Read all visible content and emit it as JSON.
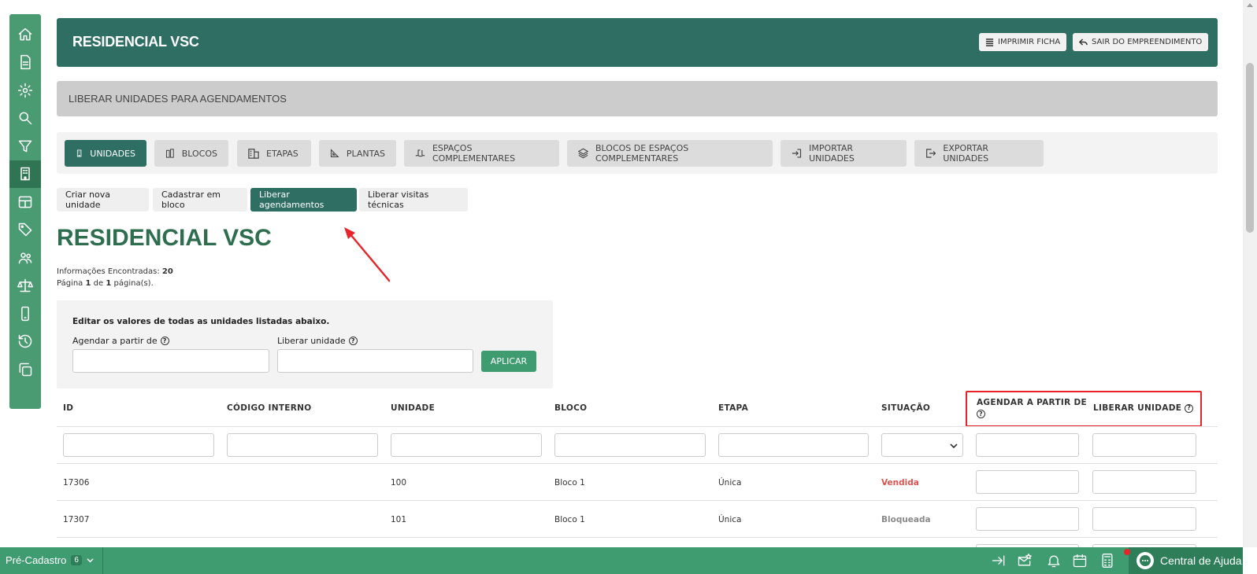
{
  "header": {
    "title": "RESIDENCIAL VSC",
    "print_label": "IMPRIMIR FICHA",
    "exit_label": "SAIR DO EMPREENDIMENTO"
  },
  "subbar": {
    "label": "LIBERAR UNIDADES PARA AGENDAMENTOS"
  },
  "tabs": [
    {
      "label": "UNIDADES",
      "icon": "building-icon",
      "active": true
    },
    {
      "label": "BLOCOS",
      "icon": "blocks-icon"
    },
    {
      "label": "ETAPAS",
      "icon": "stages-icon"
    },
    {
      "label": "PLANTAS",
      "icon": "plans-icon"
    },
    {
      "label": "ESPAÇOS COMPLEMENTARES",
      "icon": "pool-icon"
    },
    {
      "label": "BLOCOS DE ESPAÇOS COMPLEMENTARES",
      "icon": "layers-icon"
    },
    {
      "label": "IMPORTAR UNIDADES",
      "icon": "import-icon"
    },
    {
      "label": "EXPORTAR UNIDADES",
      "icon": "export-icon"
    }
  ],
  "subtabs": [
    {
      "label": "Criar nova unidade"
    },
    {
      "label": "Cadastrar em bloco"
    },
    {
      "label": "Liberar agendamentos",
      "active": true
    },
    {
      "label": "Liberar visitas técnicas"
    }
  ],
  "page_title": "RESIDENCIAL VSC",
  "info": {
    "found_label": "Informações Encontradas:",
    "found_count": "20",
    "page_prefix": "Página",
    "page_current": "1",
    "page_of": "de",
    "page_total": "1",
    "page_suffix": "página(s)."
  },
  "edit": {
    "title": "Editar os valores de todas as unidades listadas abaixo.",
    "schedule_label": "Agendar a partir de",
    "release_label": "Liberar unidade",
    "apply_label": "APLICAR"
  },
  "table": {
    "columns": [
      "ID",
      "CÓDIGO INTERNO",
      "UNIDADE",
      "BLOCO",
      "ETAPA",
      "SITUAÇÃO",
      "AGENDAR A PARTIR DE",
      "LIBERAR UNIDADE"
    ],
    "rows": [
      {
        "id": "17306",
        "code": "",
        "unit": "100",
        "block": "Bloco 1",
        "stage": "Única",
        "status": "Vendida",
        "status_color": "#d9534f"
      },
      {
        "id": "17307",
        "code": "",
        "unit": "101",
        "block": "Bloco 1",
        "stage": "Única",
        "status": "Bloqueada",
        "status_color": "#8a8a8a"
      }
    ]
  },
  "footer": {
    "pre_label": "Pré-Cadastro",
    "pre_count": "6",
    "help_label": "Central de Ajuda"
  },
  "colors": {
    "primary": "#2e6e63",
    "sidebar": "#4a9a72",
    "footer": "#3f9c71",
    "highlight": "#e8232a"
  }
}
